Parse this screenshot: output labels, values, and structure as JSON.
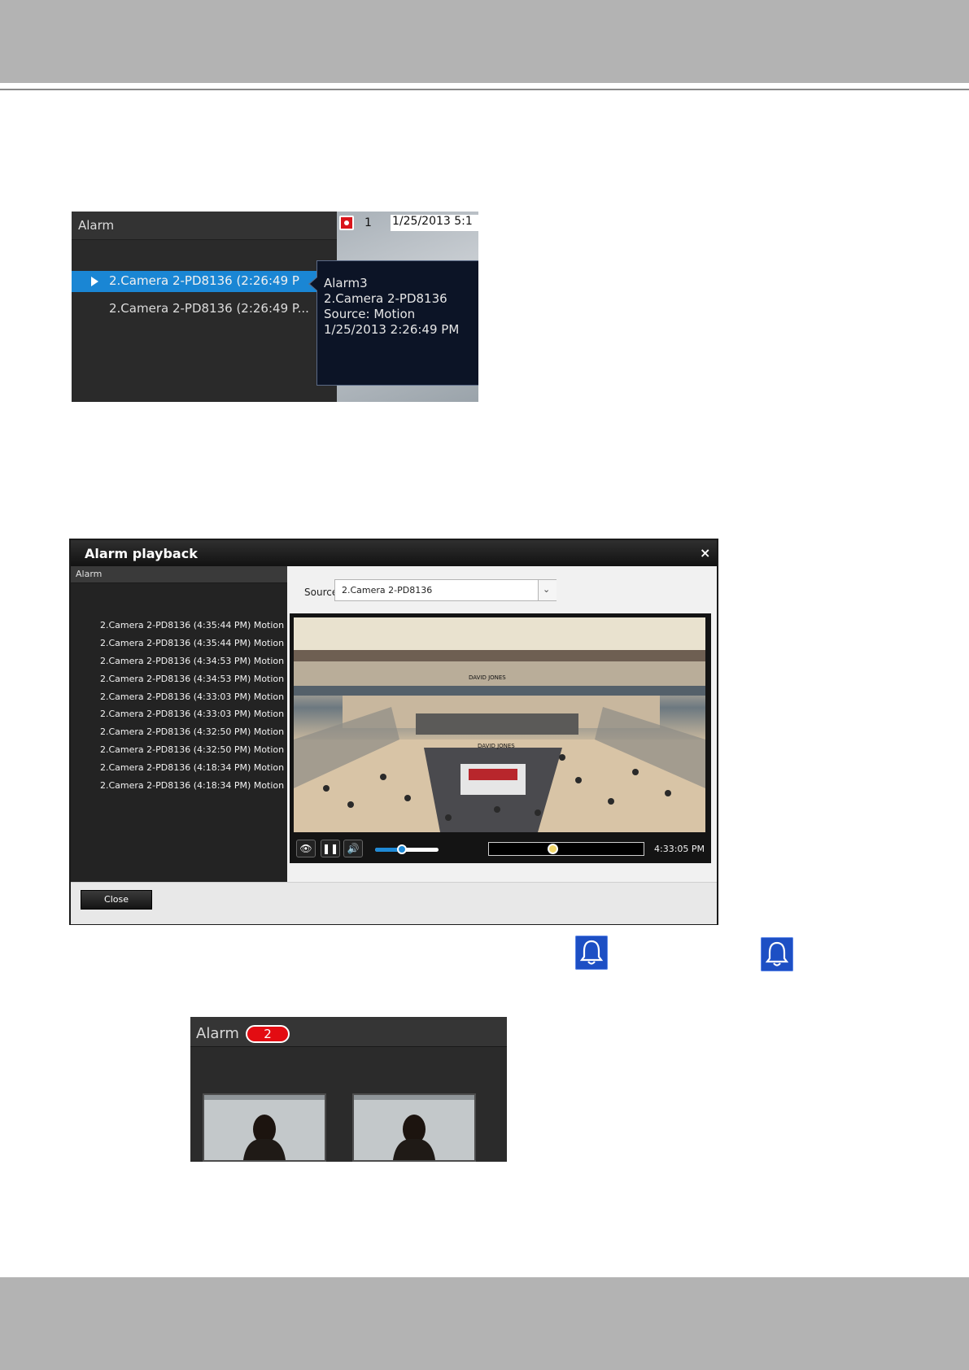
{
  "screenshot1": {
    "panel_title": "Alarm",
    "channel_number": "1",
    "timestamp": "1/25/2013 5:1",
    "rows": [
      "2.Camera 2-PD8136 (2:26:49 P",
      "2.Camera 2-PD8136 (2:26:49 P..."
    ],
    "tooltip": {
      "line1": "Alarm3",
      "line2": "2.Camera 2-PD8136",
      "line3": "Source: Motion",
      "line4": "1/25/2013 2:26:49 PM"
    },
    "colors": {
      "selected_row": "#1a86d4",
      "record": "#d9141b"
    }
  },
  "playback": {
    "title": "Alarm playback",
    "close_glyph": "×",
    "side_title": "Alarm",
    "source_label": "Source",
    "source_value": "2.Camera 2-PD8136",
    "alarms": [
      "2.Camera 2-PD8136 (4:35:44 PM) Motion",
      "2.Camera 2-PD8136 (4:35:44 PM) Motion",
      "2.Camera 2-PD8136 (4:34:53 PM) Motion",
      "2.Camera 2-PD8136 (4:34:53 PM) Motion",
      "2.Camera 2-PD8136 (4:33:03 PM) Motion",
      "2.Camera 2-PD8136 (4:33:03 PM) Motion",
      "2.Camera 2-PD8136 (4:32:50 PM) Motion",
      "2.Camera 2-PD8136 (4:32:50 PM) Motion",
      "2.Camera 2-PD8136 (4:18:34 PM) Motion",
      "2.Camera 2-PD8136 (4:18:34 PM) Motion"
    ],
    "video_signs": [
      "DAVID JONES",
      "DAVID JONES"
    ],
    "volume_level": 0.42,
    "timeline_position": 0.41,
    "playback_time": "4:33:05 PM",
    "close_button": "Close",
    "icons": [
      "eye-icon",
      "pause-icon",
      "speaker-icon",
      "chevron-down-icon"
    ]
  },
  "alarm_count": {
    "title": "Alarm",
    "count": "2",
    "badge_color": "#e30c12"
  },
  "bell_color": "#1d4fc4"
}
